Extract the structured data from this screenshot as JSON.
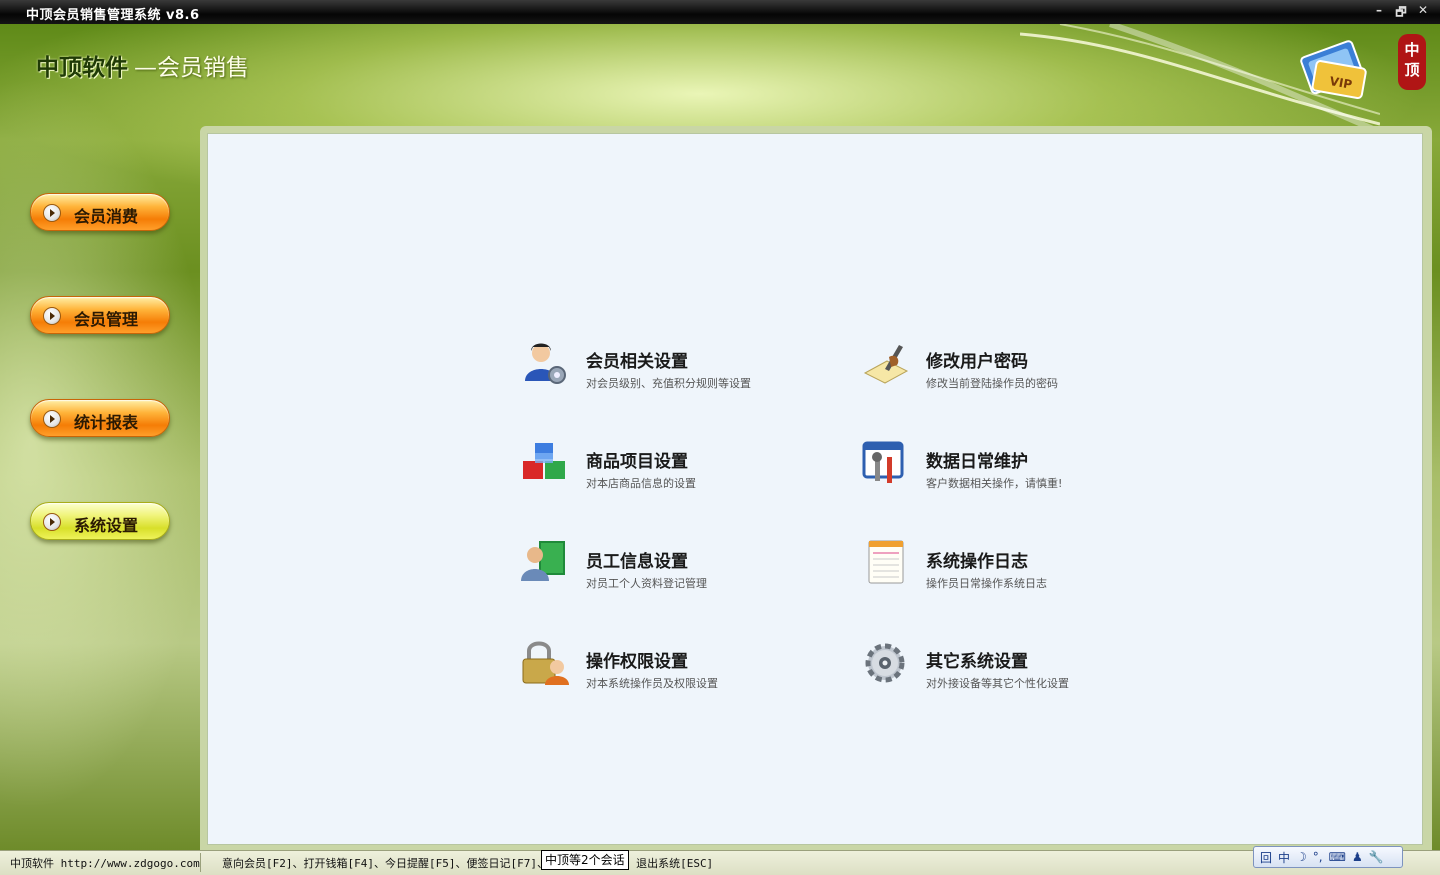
{
  "window": {
    "title": "中顶会员销售管理系统 v8.6",
    "controls": [
      "–",
      "🗗",
      "✕"
    ]
  },
  "brand": {
    "company": "中顶软件",
    "product": "—会员销售",
    "seal_text": "中顶"
  },
  "sidebar": {
    "items": [
      {
        "label": "会员消费",
        "active": false
      },
      {
        "label": "会员管理",
        "active": false
      },
      {
        "label": "统计报表",
        "active": false
      },
      {
        "label": "系统设置",
        "active": true
      }
    ]
  },
  "settings": {
    "items": [
      {
        "icon": "member-settings-icon",
        "title": "会员相关设置",
        "desc": "对会员级别、充值积分规则等设置"
      },
      {
        "icon": "change-password-icon",
        "title": "修改用户密码",
        "desc": "修改当前登陆操作员的密码"
      },
      {
        "icon": "product-settings-icon",
        "title": "商品项目设置",
        "desc": "对本店商品信息的设置"
      },
      {
        "icon": "data-maintenance-icon",
        "title": "数据日常维护",
        "desc": "客户数据相关操作，请慎重!"
      },
      {
        "icon": "employee-info-icon",
        "title": "员工信息设置",
        "desc": "对员工个人资料登记管理"
      },
      {
        "icon": "operation-log-icon",
        "title": "系统操作日志",
        "desc": "操作员日常操作系统日志"
      },
      {
        "icon": "permission-settings-icon",
        "title": "操作权限设置",
        "desc": "对本系统操作员及权限设置"
      },
      {
        "icon": "other-settings-icon",
        "title": "其它系统设置",
        "desc": "对外接设备等其它个性化设置"
      }
    ]
  },
  "statusbar": {
    "left": "中顶软件 http://www.zdgogo.com",
    "shortcuts": "意向会员[F2]、打开钱箱[F4]、今日提醒[F5]、便签日记[F7]、锁定屏幕[F10]、退出系统[ESC]",
    "ime_tip": "中顶等2个会话",
    "ime_toolbar": [
      "回",
      "中",
      "☽",
      "°,",
      "⌨",
      "♟",
      "🔧"
    ]
  }
}
